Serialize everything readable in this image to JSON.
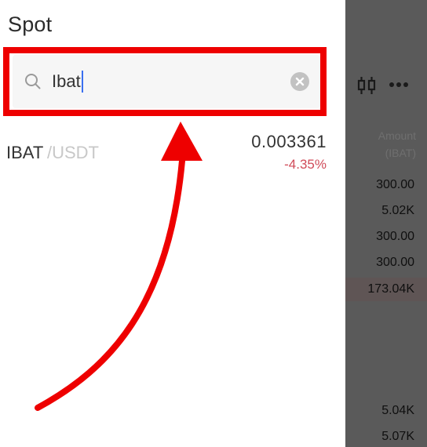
{
  "header": {
    "title": "Spot"
  },
  "search": {
    "value": "Ibat",
    "icon": "search-icon",
    "clear_icon": "clear-icon"
  },
  "results": [
    {
      "base": "IBAT",
      "quote": "/USDT",
      "price": "0.003361",
      "change": "-4.35%"
    }
  ],
  "side_panel": {
    "amount_label": "Amount",
    "amount_unit": "(IBAT)",
    "order_book": [
      "300.00",
      "5.02K",
      "300.00",
      "300.00",
      "173.04K",
      "5.04K",
      "5.07K"
    ]
  },
  "colors": {
    "annotation": "#ee0000",
    "negative": "#d04b59",
    "caret": "#3a6ff0",
    "overlay": "#5a5a5a"
  }
}
